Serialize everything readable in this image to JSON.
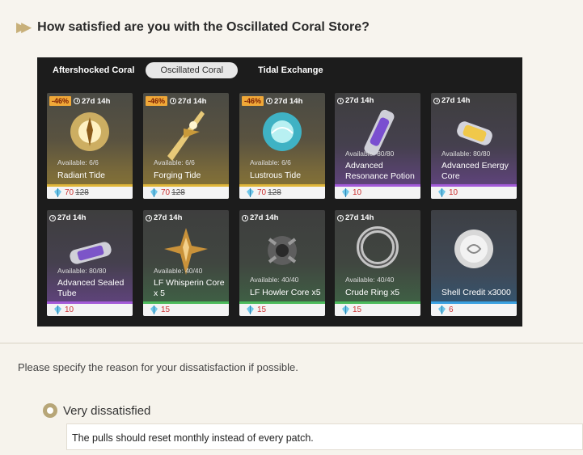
{
  "question": {
    "title": "How satisfied are you with the Oscillated Coral Store?"
  },
  "store": {
    "tabs": [
      "Aftershocked Coral",
      "Oscillated Coral",
      "Tidal Exchange"
    ],
    "active_tab": 1,
    "items": [
      {
        "discount": "-46%",
        "timer": "27d 14h",
        "available": "Available: 6/6",
        "name": "Radiant Tide",
        "price": "70",
        "old_price": "128",
        "rarity": "gold"
      },
      {
        "discount": "-46%",
        "timer": "27d 14h",
        "available": "Available: 6/6",
        "name": "Forging Tide",
        "price": "70",
        "old_price": "128",
        "rarity": "gold"
      },
      {
        "discount": "-46%",
        "timer": "27d 14h",
        "available": "Available: 6/6",
        "name": "Lustrous Tide",
        "price": "70",
        "old_price": "128",
        "rarity": "gold"
      },
      {
        "discount": "",
        "timer": "27d 14h",
        "available": "Available: 80/80",
        "name": "Advanced Resonance Potion",
        "price": "10",
        "old_price": "",
        "rarity": "purple"
      },
      {
        "discount": "",
        "timer": "27d 14h",
        "available": "Available: 80/80",
        "name": "Advanced Energy Core",
        "price": "10",
        "old_price": "",
        "rarity": "purple"
      },
      {
        "discount": "",
        "timer": "27d 14h",
        "available": "Available: 80/80",
        "name": "Advanced Sealed Tube",
        "price": "10",
        "old_price": "",
        "rarity": "purple"
      },
      {
        "discount": "",
        "timer": "27d 14h",
        "available": "Available: 40/40",
        "name": "LF Whisperin Core x 5",
        "price": "15",
        "old_price": "",
        "rarity": "green"
      },
      {
        "discount": "",
        "timer": "27d 14h",
        "available": "Available: 40/40",
        "name": "LF Howler Core x5",
        "price": "15",
        "old_price": "",
        "rarity": "green"
      },
      {
        "discount": "",
        "timer": "27d 14h",
        "available": "Available: 40/40",
        "name": "Crude Ring x5",
        "price": "15",
        "old_price": "",
        "rarity": "green"
      },
      {
        "discount": "",
        "timer": "",
        "available": "",
        "name": "Shell Credit x3000",
        "price": "6",
        "old_price": "",
        "rarity": "blue"
      }
    ]
  },
  "followup": {
    "prompt": "Please specify the reason for your dissatisfaction if possible.",
    "selected_option": "Very dissatisfied",
    "answer": "The pulls should reset monthly instead of every patch."
  },
  "colors": {
    "gold": "#e0b63a",
    "purple": "#a35bd8",
    "green": "#4cbb5c",
    "blue": "#3aa0e0"
  }
}
